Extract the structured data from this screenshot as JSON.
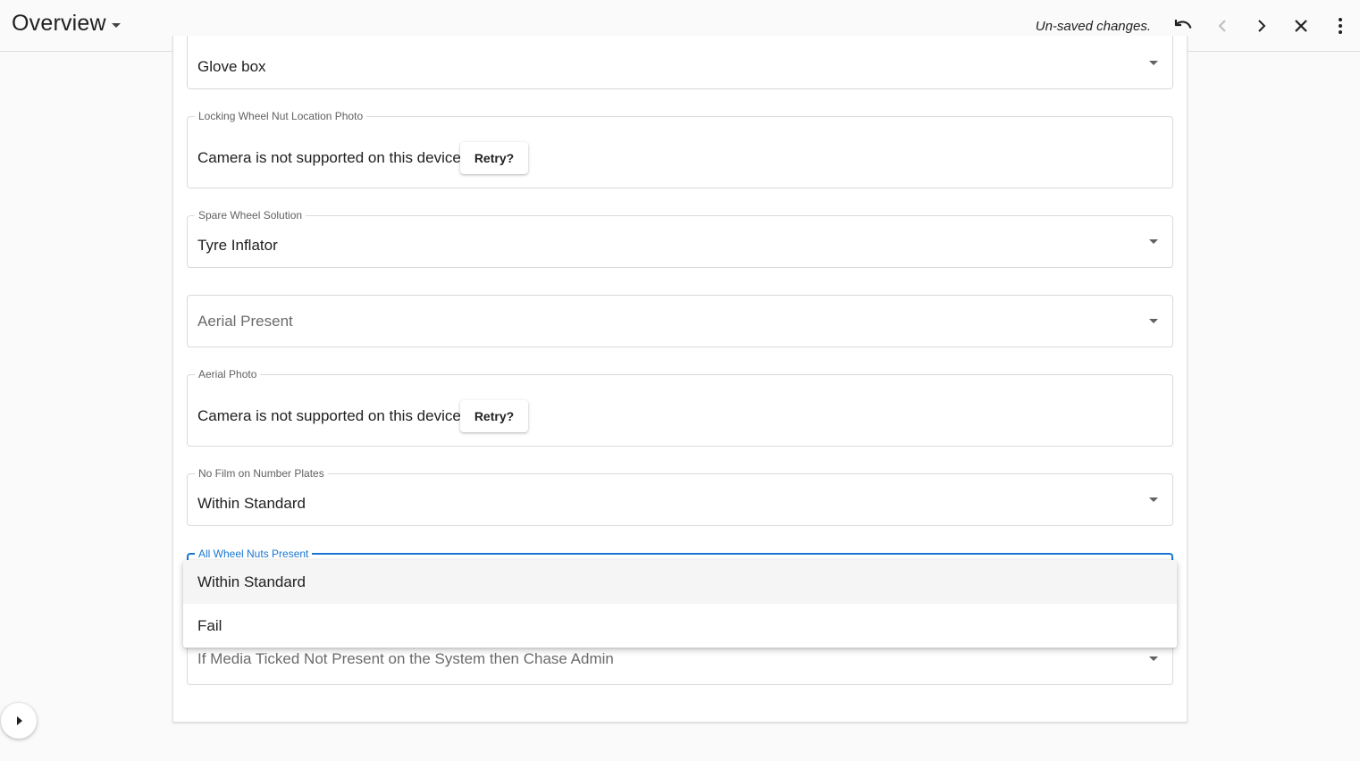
{
  "header": {
    "title": "Overview",
    "unsaved_text": "Un-saved changes.",
    "icons": {
      "undo": "undo-icon",
      "prev": "chevron-left-icon",
      "next": "chevron-right-icon",
      "close": "close-icon",
      "more": "more-vertical-icon"
    }
  },
  "form": {
    "glove_box": {
      "value": "Glove box"
    },
    "locking_nut_photo": {
      "label": "Locking Wheel Nut Location Photo",
      "message": "Camera is not supported on this device",
      "retry_label": "Retry?"
    },
    "spare_wheel": {
      "label": "Spare Wheel Solution",
      "value": "Tyre Inflator"
    },
    "aerial_present": {
      "placeholder": "Aerial Present"
    },
    "aerial_photo": {
      "label": "Aerial Photo",
      "message": "Camera is not supported on this device",
      "retry_label": "Retry?"
    },
    "no_film": {
      "label": "No Film on Number Plates",
      "value": "Within Standard"
    },
    "all_wheel_nuts": {
      "label": "All Wheel Nuts Present"
    },
    "media_chase": {
      "placeholder": "If Media Ticked Not Present on the System then Chase Admin"
    }
  },
  "dropdown": {
    "options": [
      {
        "label": "Within Standard",
        "highlighted": true
      },
      {
        "label": "Fail",
        "highlighted": false
      }
    ]
  },
  "colors": {
    "accent": "#1976d2",
    "background": "#fafafa"
  }
}
